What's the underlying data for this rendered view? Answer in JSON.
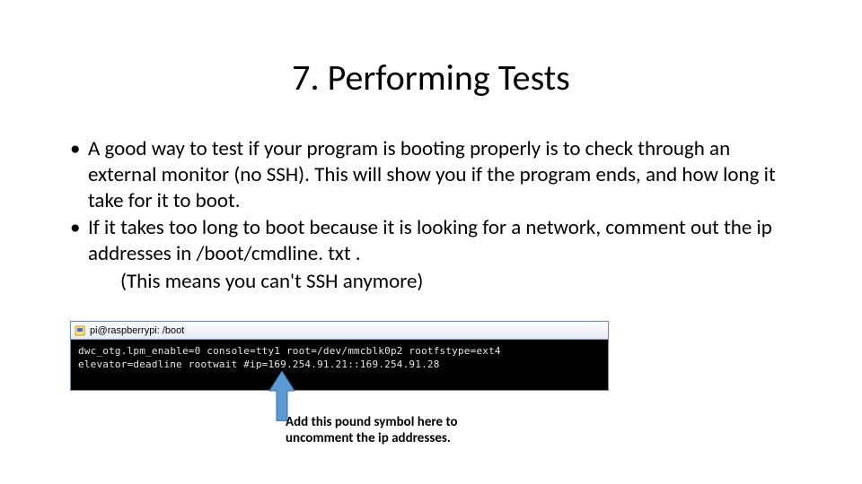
{
  "title": "7. Performing Tests",
  "bullets": [
    "A good way to test if your program is booting properly is to check through an external monitor (no SSH). This will show you if the program ends, and how long it take for it to boot.",
    "If it takes too long to boot because it is looking for a network, comment out the ip addresses in /boot/cmdline. txt ."
  ],
  "indent_note": "(This means you can't SSH anymore)",
  "terminal": {
    "title": "pi@raspberrypi: /boot",
    "line1": "dwc_otg.lpm_enable=0 console=tty1 root=/dev/mmcblk0p2 rootfstype=ext4",
    "line2": "elevator=deadline rootwait #ip=169.254.91.21::169.254.91.28"
  },
  "caption": {
    "line1": "Add this pound symbol here to",
    "line2": "uncomment the ip addresses."
  },
  "bullet_char": "•"
}
